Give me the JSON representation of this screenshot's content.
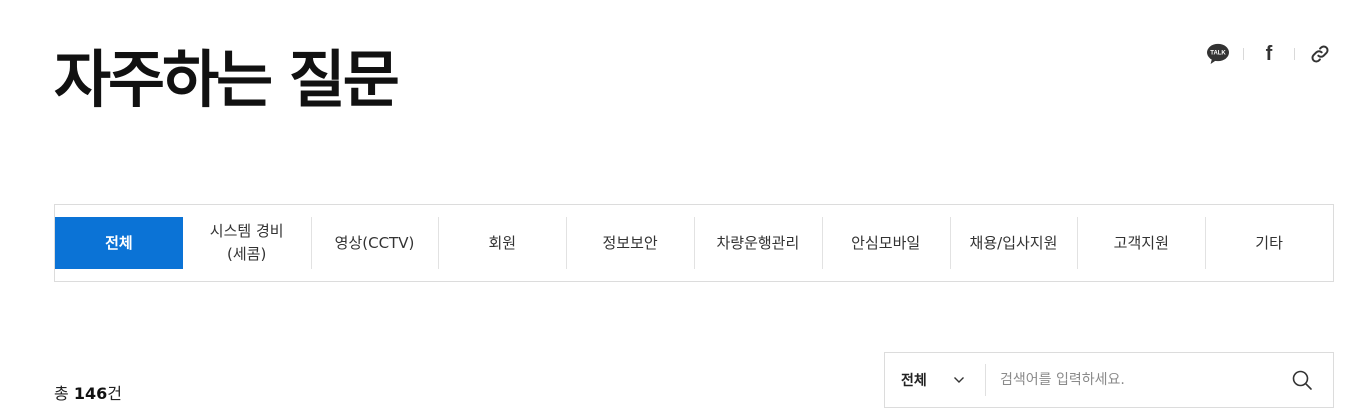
{
  "page": {
    "title": "자주하는 질문"
  },
  "share": {
    "kakaotalk": {
      "icon": "kakaotalk-icon",
      "label": "TALK"
    },
    "facebook": {
      "icon": "facebook-icon",
      "label": "f"
    },
    "link": {
      "icon": "link-icon"
    }
  },
  "tabs": [
    {
      "label": "전체",
      "active": true
    },
    {
      "label": "시스템 경비\n(세콤)",
      "active": false
    },
    {
      "label": "영상(CCTV)",
      "active": false
    },
    {
      "label": "회원",
      "active": false
    },
    {
      "label": "정보보안",
      "active": false
    },
    {
      "label": "차량운행관리",
      "active": false
    },
    {
      "label": "안심모바일",
      "active": false
    },
    {
      "label": "채용/입사지원",
      "active": false
    },
    {
      "label": "고객지원",
      "active": false
    },
    {
      "label": "기타",
      "active": false
    }
  ],
  "results": {
    "prefix": "총 ",
    "count": "146",
    "suffix": "건"
  },
  "search": {
    "scope_selected": "전체",
    "placeholder": "검색어를 입력하세요.",
    "value": "",
    "icons": {
      "dropdown": "chevron-down-icon",
      "submit": "search-icon"
    }
  },
  "colors": {
    "accent": "#0b73d6",
    "border": "#dcdcdc",
    "text": "#111111"
  }
}
